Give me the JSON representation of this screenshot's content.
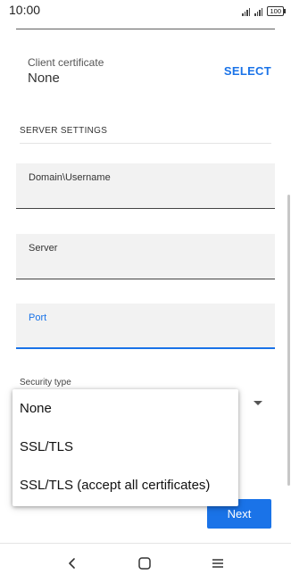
{
  "status_bar": {
    "time": "10:00",
    "battery": "100"
  },
  "client_certificate": {
    "label": "Client certificate",
    "value": "None",
    "action": "SELECT"
  },
  "server_settings": {
    "title": "SERVER SETTINGS",
    "fields": [
      {
        "label": "Domain\\Username",
        "value": ""
      },
      {
        "label": "Server",
        "value": ""
      },
      {
        "label": "Port",
        "value": ""
      }
    ],
    "security_type_label": "Security type"
  },
  "security_menu": {
    "options": [
      "None",
      "SSL/TLS",
      "SSL/TLS (accept all certificates)"
    ]
  },
  "buttons": {
    "next": "Next"
  },
  "colors": {
    "accent": "#1a73e8"
  },
  "icons": {
    "back": "chevron-left-icon",
    "home": "square-home-icon",
    "recents": "menu-lines-icon"
  }
}
